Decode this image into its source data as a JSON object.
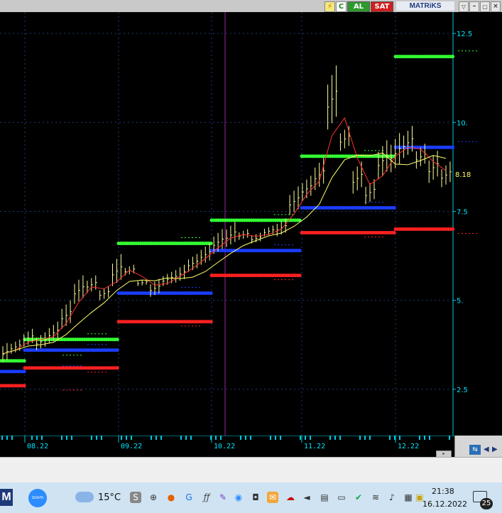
{
  "toolbar": {
    "buy_label": "AL",
    "sell_label": "SAT",
    "brand": "MATRiKS"
  },
  "chart_data": {
    "type": "line",
    "y_axis": {
      "ticks": [
        "12.5",
        "10.",
        "7.5",
        "5.",
        "2.5"
      ],
      "ylim": [
        1.2,
        13.1
      ],
      "current_price_label": "8.18"
    },
    "x_axis": {
      "labels": [
        "08.22",
        "09.22",
        "10.22",
        "11.22",
        "12.22"
      ]
    },
    "colors": {
      "background": "#000000",
      "axis_text": "#00e5ff",
      "price_label": "#ffff66",
      "grid": "#1e3a78",
      "candles": "#ffff99",
      "ma_fast": "#ff3030",
      "ma_slow": "#ffff66",
      "upper_band": "#33ff33",
      "middle_band": "#1a3dff",
      "lower_band": "#ff2020"
    },
    "series": [
      {
        "kind": "price",
        "points": [
          [
            3.2,
            3.8
          ],
          [
            3.5,
            3.9
          ],
          [
            3.7,
            4.2
          ],
          [
            3.6,
            4.1
          ],
          [
            3.8,
            4.4
          ],
          [
            4.2,
            5.0
          ],
          [
            4.9,
            5.7
          ],
          [
            5.2,
            5.7
          ],
          [
            5.0,
            5.4
          ],
          [
            5.4,
            6.3
          ],
          [
            5.7,
            6.0
          ],
          [
            5.4,
            5.6
          ],
          [
            5.1,
            5.6
          ],
          [
            5.4,
            5.8
          ],
          [
            5.5,
            6.0
          ],
          [
            5.8,
            6.3
          ],
          [
            6.0,
            6.6
          ],
          [
            6.3,
            7.0
          ],
          [
            6.5,
            7.2
          ],
          [
            6.7,
            7.0
          ],
          [
            6.6,
            6.9
          ],
          [
            6.8,
            7.1
          ],
          [
            6.8,
            7.3
          ],
          [
            7.4,
            8.2
          ],
          [
            7.8,
            8.5
          ],
          [
            8.1,
            9.0
          ],
          [
            9.8,
            11.6
          ],
          [
            9.2,
            9.9
          ],
          [
            8.0,
            8.9
          ],
          [
            7.7,
            8.4
          ],
          [
            8.4,
            9.5
          ],
          [
            8.6,
            9.7
          ],
          [
            9.0,
            9.9
          ],
          [
            8.7,
            9.4
          ],
          [
            8.3,
            9.2
          ],
          [
            8.18,
            8.9
          ]
        ]
      }
    ],
    "bands": {
      "upper": [
        3.3,
        3.9,
        6.6,
        7.25,
        9.05,
        11.85
      ],
      "middle": [
        3.0,
        3.6,
        5.2,
        6.4,
        7.6,
        9.3
      ],
      "lower": [
        2.6,
        3.1,
        4.4,
        5.7,
        6.9,
        7.0
      ]
    }
  },
  "statusbar": {},
  "taskbar": {
    "temperature": "15°C",
    "time": "21:38",
    "date": "16.12.2022",
    "notification_count": "25"
  }
}
